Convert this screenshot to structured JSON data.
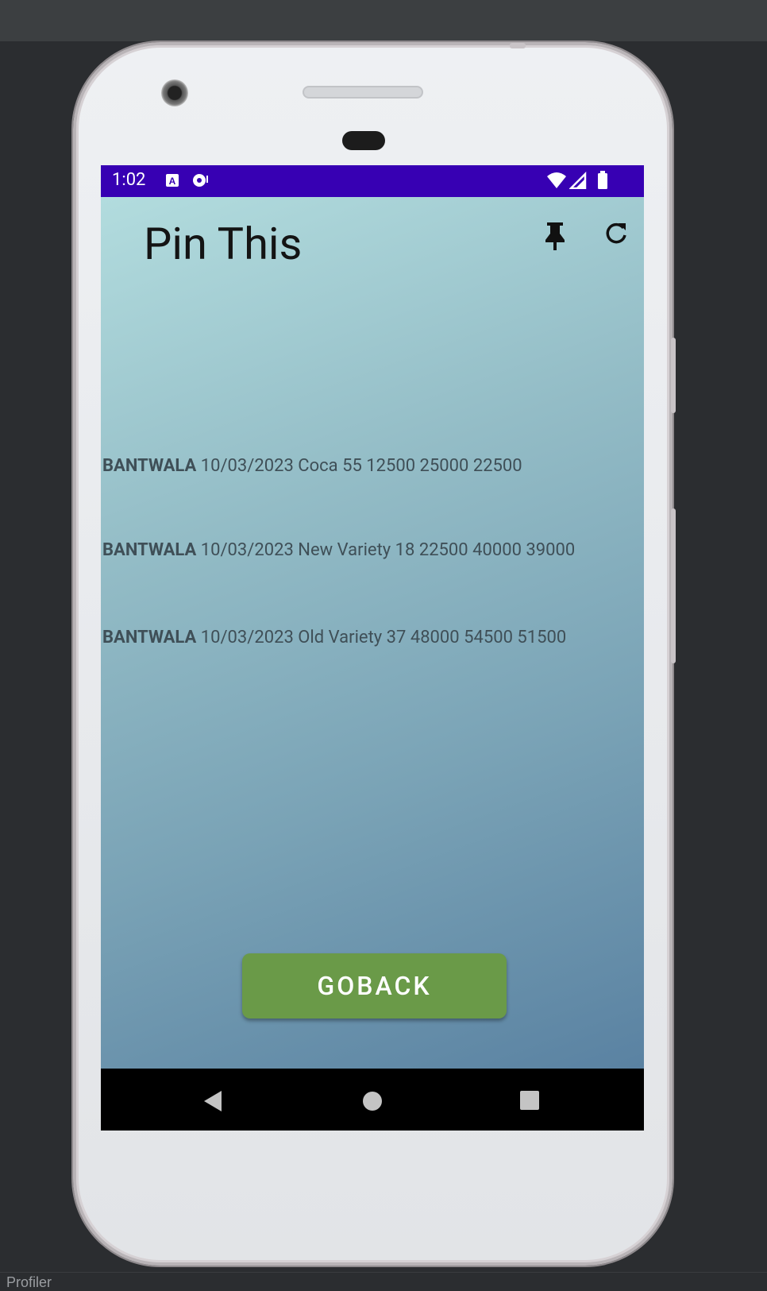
{
  "ide": {
    "bottom_label": "Profiler"
  },
  "status": {
    "time": "1:02"
  },
  "app": {
    "title": "Pin This",
    "button_label": "GOBACK"
  },
  "rows": [
    {
      "market": "BANTWALA",
      "text": " 10/03/2023 Coca 55 12500 25000 22500"
    },
    {
      "market": "BANTWALA",
      "text": " 10/03/2023 New Variety 18 22500 40000 39000"
    },
    {
      "market": "BANTWALA",
      "text": " 10/03/2023 Old Variety 37 48000 54500 51500"
    }
  ],
  "icons": [
    "pin-icon",
    "refresh-icon",
    "back-icon",
    "home-icon",
    "recents-icon",
    "wifi-icon",
    "signal-icon",
    "battery-icon"
  ],
  "colors": {
    "status_bar": "#3700b3",
    "button": "#6a9a48",
    "nav_bar": "#000000"
  }
}
